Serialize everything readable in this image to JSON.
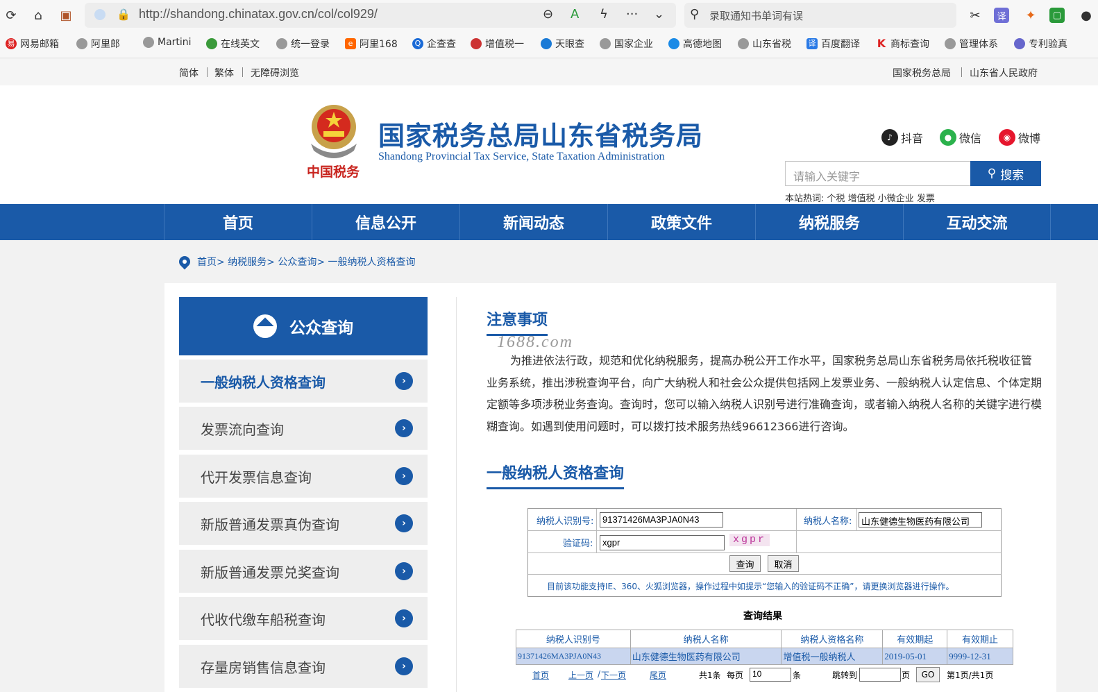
{
  "browser": {
    "url": "http://shandong.chinatax.gov.cn/col/col929/",
    "search_text": "录取通知书单词有误",
    "bookmarks": [
      "网易邮箱",
      "阿里郎",
      "Martini",
      "在线英文",
      "统一登录",
      "阿里168",
      "企查查",
      "增值税一",
      "天眼查",
      "国家企业",
      "高德地图",
      "山东省税",
      "百度翻译",
      "商标查询",
      "管理体系",
      "专利验真"
    ]
  },
  "util": {
    "simplified": "简体",
    "traditional": "繁体",
    "accessible": "无障碍浏览",
    "link_state": "国家税务总局",
    "link_gov": "山东省人民政府"
  },
  "header": {
    "title_cn": "国家税务总局山东省税务局",
    "title_en": "Shandong Provincial Tax Service, State Taxation Administration",
    "emblem_text": "中国税务",
    "social": [
      "抖音",
      "微信",
      "微博"
    ],
    "search_placeholder": "请输入关键字",
    "search_button": "搜索",
    "hotwords": "本站热词: 个税 增值税 小微企业 发票"
  },
  "nav": [
    "首页",
    "信息公开",
    "新闻动态",
    "政策文件",
    "纳税服务",
    "互动交流"
  ],
  "breadcrumb": "首页> 纳税服务> 公众查询> 一般纳税人资格查询",
  "sidebar": {
    "title": "公众查询",
    "items": [
      "一般纳税人资格查询",
      "发票流向查询",
      "代开发票信息查询",
      "新版普通发票真伪查询",
      "新版普通发票兑奖查询",
      "代收代缴车船税查询",
      "存量房销售信息查询"
    ]
  },
  "notice": {
    "title": "注意事项",
    "watermark": "1688.com",
    "text": "为推进依法行政，规范和优化纳税服务，提高办税公开工作水平，国家税务总局山东省税务局依托税收征管业务系统，推出涉税查询平台，向广大纳税人和社会公众提供包括网上发票业务、一般纳税人认定信息、个体定期定额等多项涉税业务查询。查询时，您可以输入纳税人识别号进行准确查询，或者输入纳税人名称的关键字进行模糊查询。如遇到使用问题时，可以拨打技术服务热线96612366进行咨询。"
  },
  "query": {
    "title": "一般纳税人资格查询",
    "id_label": "纳税人识别号:",
    "id_value": "91371426MA3PJA0N43",
    "name_label": "纳税人名称:",
    "name_value": "山东健德生物医药有限公司",
    "code_label": "验证码:",
    "code_value": "xgpr",
    "captcha": "xgpr",
    "submit": "查询",
    "cancel": "取消",
    "note": "目前该功能支持IE、360、火狐浏览器，操作过程中如提示“您输入的验证码不正确”，请更换浏览器进行操作。"
  },
  "result": {
    "title": "查询结果",
    "headers": [
      "纳税人识别号",
      "纳税人名称",
      "纳税人资格名称",
      "有效期起",
      "有效期止"
    ],
    "row": [
      "91371426MA3PJA0N43",
      "山东健德生物医药有限公司",
      "增值税一般纳税人",
      "2019-05-01",
      "9999-12-31"
    ]
  },
  "pager": {
    "first": "首页",
    "prev": "上一页",
    "slash": "/",
    "next": "下一页",
    "last": "尾页",
    "total": "共1条",
    "per_page": "每页",
    "per_page_value": "10",
    "unit": "条",
    "goto": "跳转到",
    "page_unit": "页",
    "go": "GO",
    "status": "第1页/共1页"
  }
}
